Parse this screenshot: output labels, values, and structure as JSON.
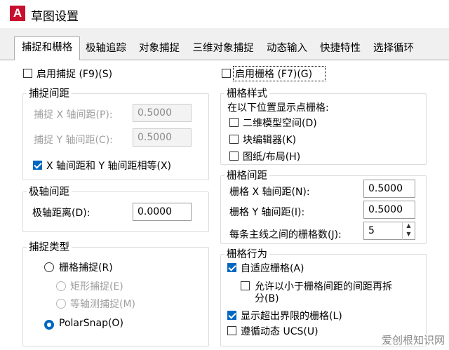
{
  "window": {
    "title": "草图设置",
    "app_icon": "A"
  },
  "tabs": [
    {
      "label": "捕捉和栅格",
      "active": true
    },
    {
      "label": "极轴追踪"
    },
    {
      "label": "对象捕捉"
    },
    {
      "label": "三维对象捕捉"
    },
    {
      "label": "动态输入"
    },
    {
      "label": "快捷特性"
    },
    {
      "label": "选择循环"
    }
  ],
  "left": {
    "snap_on": {
      "label": "启用捕捉 (F9)(S)",
      "checked": false
    },
    "snap_spacing": {
      "legend": "捕捉间距",
      "x_label": "捕捉 X 轴间距(P):",
      "x_value": "0.5000",
      "y_label": "捕捉 Y 轴间距(C):",
      "y_value": "0.5000",
      "equal_label": "X 轴间距和 Y 轴间距相等(X)",
      "equal_checked": true
    },
    "polar_spacing": {
      "legend": "极轴间距",
      "distance_label": "极轴距离(D):",
      "distance_value": "0.0000"
    },
    "snap_type": {
      "legend": "捕捉类型",
      "grid_snap": "栅格捕捉(R)",
      "rect_snap": "矩形捕捉(E)",
      "iso_snap": "等轴测捕捉(M)",
      "polarsnap": "PolarSnap(O)"
    }
  },
  "right": {
    "grid_on": {
      "label": "启用栅格 (F7)(G)",
      "checked": false
    },
    "grid_style": {
      "legend": "栅格样式",
      "desc": "在以下位置显示点栅格:",
      "model_space": "二维模型空间(D)",
      "block_editor": "块编辑器(K)",
      "paper_layout": "图纸/布局(H)"
    },
    "grid_spacing": {
      "legend": "栅格间距",
      "x_label": "栅格 X 轴间距(N):",
      "x_value": "0.5000",
      "y_label": "栅格 Y 轴间距(I):",
      "y_value": "0.5000",
      "major_label": "每条主线之间的栅格数(J):",
      "major_value": "5"
    },
    "grid_behavior": {
      "legend": "栅格行为",
      "adaptive": "自适应栅格(A)",
      "adaptive_checked": true,
      "subdivide_line1": "允许以小于栅格间距的间距再拆",
      "subdivide_line2": "分(B)",
      "subdivide_checked": false,
      "beyond_limits": "显示超出界限的栅格(L)",
      "beyond_checked": true,
      "follow_ucs": "遵循动态 UCS(U)",
      "follow_checked": false
    }
  },
  "watermark": "爱创根知识网"
}
